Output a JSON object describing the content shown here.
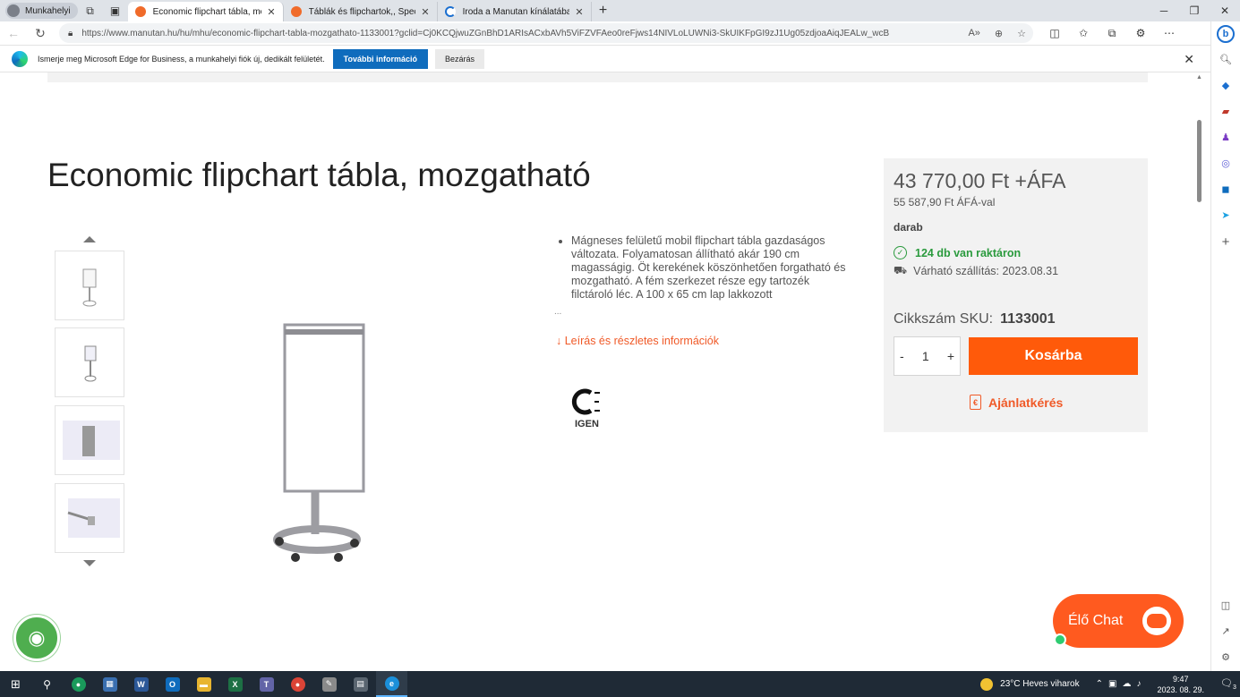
{
  "browser": {
    "profile": "Munkahelyi",
    "tabs": [
      {
        "title": "Economic flipchart tábla, mozgat",
        "active": true
      },
      {
        "title": "Táblák és flipchartok,, Speciális tá",
        "active": false
      },
      {
        "title": "Iroda a Manutan kínálatában.",
        "active": false
      }
    ],
    "url": "https://www.manutan.hu/hu/mhu/economic-flipchart-tabla-mozgathato-1133001?gclid=Cj0KCQjwuZGnBhD1ARIsACxbAVh5ViFZVFAeo0reFjws14NIVLoLUWNi3-SkUIKFpGI9zJ1Ug05zdjoaAiqJEALw_wcB",
    "infobar": {
      "text": "Ismerje meg Microsoft Edge for Business, a munkahelyi fiók új, dedikált felületét.",
      "primary": "További információ",
      "secondary": "Bezárás"
    },
    "sidebar_icons": [
      "bing-icon",
      "search-icon",
      "shopping-tag-icon",
      "briefcase-icon",
      "games-icon",
      "office-icon",
      "outlook-icon",
      "send-icon",
      "add-icon"
    ]
  },
  "product": {
    "title": "Economic flipchart tábla, mozgatható",
    "description": "Mágneses felületű mobil flipchart tábla gazdaságos változata. Folyamatosan állítható akár 190 cm magasságig. Öt kerekének köszönhetően forgatható és mozgatható. A fém szerkezet része egy tartozék filctároló léc. A 100 x 65 cm lap lakkozott",
    "ellipsis": "...",
    "details_link": "↓ Leírás és részletes információk",
    "ce_label": "IGEN",
    "price_net": "43 770,00 Ft +ÁFA",
    "price_gross": "55 587,90 Ft ÁFÁ-val",
    "unit": "darab",
    "stock": "124 db van raktáron",
    "shipping": "Várható szállítás: 2023.08.31",
    "sku_label": "Cikkszám SKU:",
    "sku": "1133001",
    "qty_minus": "-",
    "qty": "1",
    "qty_plus": "+",
    "cart_button": "Kosárba",
    "quote_button": "Ajánlatkérés"
  },
  "chat": {
    "label": "Élő Chat"
  },
  "taskbar": {
    "weather": "23°C  Heves viharok",
    "time": "9:47",
    "date": "2023. 08. 29.",
    "notif_count": "3"
  },
  "colors": {
    "accent": "#ff5a0a",
    "stock_green": "#2a9a3d",
    "link_orange": "#f05a28",
    "edge_blue": "#0f6cbd"
  }
}
